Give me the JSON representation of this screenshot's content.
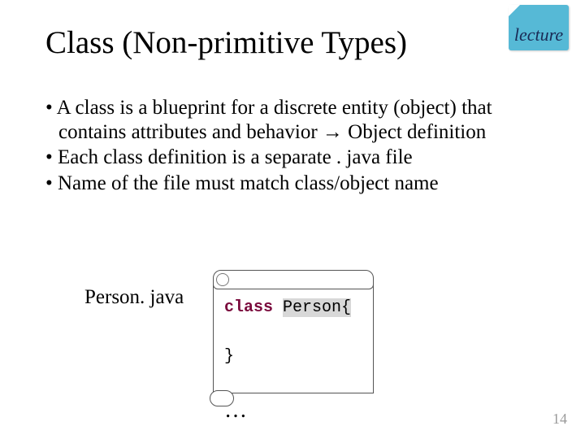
{
  "badge": {
    "text": "lecture"
  },
  "title": "Class (Non-primitive Types)",
  "bullets": [
    "• A class is a blueprint for a discrete entity (object) that contains attributes and behavior → Object definition",
    "• Each class definition is a separate . java file",
    "• Name of the file must match class/object name"
  ],
  "filename": "Person. java",
  "code": {
    "keyword": "class",
    "classname": "Person{",
    "close": "}",
    "ellipsis": "…"
  },
  "page_number": "14"
}
